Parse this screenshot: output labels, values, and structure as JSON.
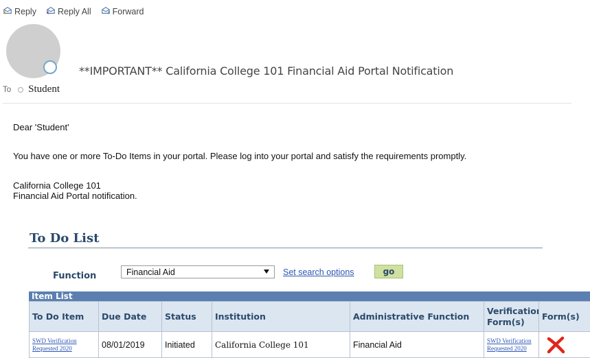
{
  "toolbar": {
    "reply": "Reply",
    "reply_all": "Reply All",
    "forward": "Forward"
  },
  "email": {
    "subject": "**IMPORTANT** California College 101 Financial Aid Portal Notification",
    "to_label": "To",
    "recipient": "Student",
    "greeting": "Dear 'Student'",
    "message": "You have one or more To-Do Items in your portal. Please log into your portal and satisfy the requirements promptly.",
    "signature_line1": "California College 101",
    "signature_line2": "Financial Aid Portal notification."
  },
  "todo": {
    "title": "To Do List",
    "function_label": "Function",
    "function_value": "Financial Aid",
    "search_options": "Set search options",
    "go_label": "go",
    "item_list_label": "Item List",
    "columns": [
      "To Do Item",
      "Due Date",
      "Status",
      "Institution",
      "Administrative Function",
      "Verification Form(s)",
      "Form(s)"
    ],
    "rows": [
      {
        "item": "SWD Verification Requested 2020",
        "due_date": "08/01/2019",
        "status": "Initiated",
        "institution": "California College 101",
        "admin_function": "Financial Aid",
        "verification_form": "SWD Verification Requested 2020",
        "form_icon": "red-x-icon"
      }
    ]
  },
  "colors": {
    "header_blue": "#2a4a6b",
    "item_bar": "#5b7fb0",
    "table_header": "#dce6f1",
    "link": "#2d56b4",
    "go_button": "#cfe0a0",
    "x_red": "#e0261b"
  }
}
